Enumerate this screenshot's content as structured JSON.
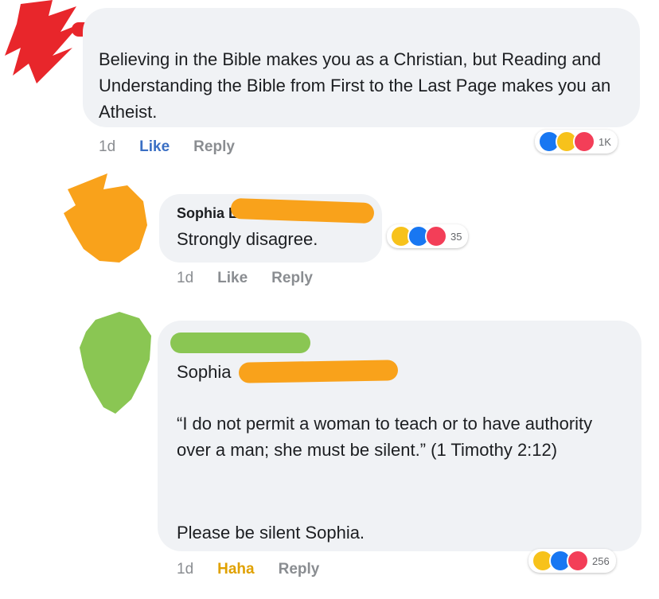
{
  "comments": [
    {
      "text": "Believing in the Bible makes you as a Christian, but Reading and Understanding the Bible from First to the Last Page makes you an Atheist.",
      "time": "1d",
      "like_label": "Like",
      "reply_label": "Reply",
      "reaction_count": "1K",
      "reaction_icons": [
        "like-icon",
        "haha-icon",
        "love-icon"
      ]
    },
    {
      "author": "Sophia L..",
      "text": "Strongly disagree.",
      "time": "1d",
      "like_label": "Like",
      "reply_label": "Reply",
      "reaction_count": "35",
      "reaction_icons": [
        "haha-icon",
        "like-icon",
        "love-icon"
      ]
    },
    {
      "mention": "Sophia",
      "quote": "“I do not permit a woman to teach or to have authority over a man; she must be silent.” (1 Timothy 2:12)",
      "closing": "Please be silent Sophia.",
      "time": "1d",
      "reaction_label": "Haha",
      "reply_label": "Reply",
      "reaction_count": "256",
      "reaction_icons": [
        "haha-icon",
        "like-icon",
        "love-icon"
      ]
    }
  ],
  "colors": {
    "bubble": "#f0f2f5",
    "like_blue": "#1877f2",
    "haha_yellow": "#f7c21b",
    "love_red": "#f33e58",
    "redact_red": "#e8262b",
    "redact_orange": "#f9a21b",
    "redact_green": "#8ac653"
  }
}
